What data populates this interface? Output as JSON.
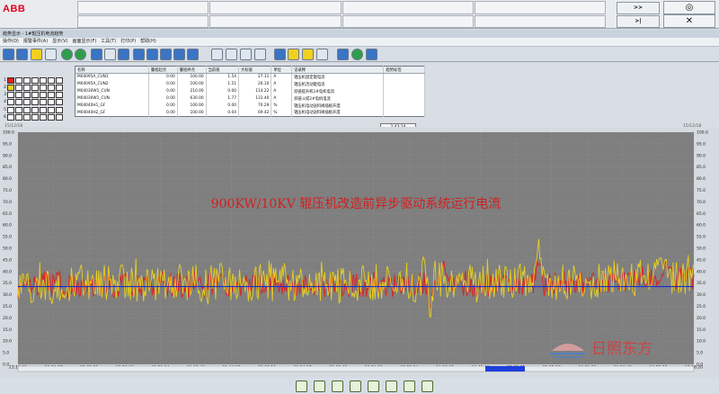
{
  "app": {
    "logo": "ABB"
  },
  "nav": {
    "forward": ">>",
    "back": ">|"
  },
  "window": {
    "title": "趋势显示 - 1#辊压机电流趋势"
  },
  "menu": [
    "操作(O)",
    "报警事件(A)",
    "显示(V)",
    "画面显示(F)",
    "工具(T)",
    "打印(P)",
    "帮助(H)"
  ],
  "legend": {
    "headers": [
      "名称",
      "量程起点",
      "量程终点",
      "当前值",
      "大标值",
      "单位",
      "记录释",
      "趋势标签"
    ],
    "rows": [
      {
        "num": "1",
        "color": "#e02020",
        "name": "M04095A_CUN1",
        "min": "0.00",
        "max": "100.00",
        "cur": "1.54",
        "big": "27.11",
        "unit": "A",
        "desc": "辊压机固定辊电流"
      },
      {
        "num": "2",
        "color": "#e8d020",
        "name": "M04095A_CUN2",
        "min": "0.00",
        "max": "100.00",
        "cur": "1.51",
        "big": "26.10",
        "unit": "A",
        "desc": "辊压机活动辊电流"
      },
      {
        "num": "3",
        "color": "#ffffff",
        "name": "M04030W1_CUN",
        "min": "0.00",
        "max": "210.00",
        "cur": "0.00",
        "big": "114.22",
        "unit": "A",
        "desc": "斜链提升机1#电机电流"
      },
      {
        "num": "4",
        "color": "#ffffff",
        "name": "M04030W1_CUN",
        "min": "0.00",
        "max": "630.00",
        "cur": "1.77",
        "big": "131.40",
        "unit": "A",
        "desc": "斜链斗提2#电机电流"
      },
      {
        "num": "5",
        "color": "#ffffff",
        "name": "M04040H1_GF",
        "min": "0.00",
        "max": "100.00",
        "cur": "0.00",
        "big": "70.29",
        "unit": "%",
        "desc": "辊压机电动送料阀插板开度"
      },
      {
        "num": "6",
        "color": "#ffffff",
        "name": "M04040H2_GF",
        "min": "0.00",
        "max": "100.00",
        "cur": "0.04",
        "big": "69.42",
        "unit": "%",
        "desc": "辊压机电动送料阀插板开度"
      }
    ]
  },
  "time_strip": {
    "left": "15/12/18",
    "center": "2:43:34",
    "right": "15/12/18"
  },
  "chart_data": {
    "type": "line",
    "title": "900KW/10KV 辊压机改造前异步驱动系统运行电流",
    "ylim": [
      0,
      100
    ],
    "y_ticks": [
      "100.0",
      "95.0",
      "90.0",
      "85.0",
      "80.0",
      "75.0",
      "70.0",
      "65.0",
      "60.0",
      "55.0",
      "50.0",
      "45.0",
      "40.0",
      "35.0",
      "30.0",
      "25.0",
      "20.0",
      "15.0",
      "10.0",
      "5.0",
      "0.0"
    ],
    "x_ticks": [
      "23:10:35",
      "23:36:37",
      "00:02:22",
      "00:28:08",
      "00:53:54",
      "01:19:40",
      "01:44:25",
      "02:10:11",
      "02:34:57",
      "03:00:43",
      "03:26:28",
      "03:52:14",
      "04:18:00",
      "04:43:46",
      "05:09:31",
      "05:35:17",
      "06:01:03",
      "06:26:49",
      "06:52:35",
      "07:18:20"
    ],
    "reference_value": 33.5,
    "grid": true,
    "series": [
      {
        "color": "#e02020",
        "base": 34,
        "noise": 5,
        "bumps": [
          [
            0.3,
            41,
            0.004
          ],
          [
            0.63,
            46,
            0.004
          ],
          [
            0.77,
            49,
            0.005
          ],
          [
            0.96,
            42,
            0.01
          ]
        ],
        "dips": [
          [
            0.61,
            24,
            0.003
          ]
        ]
      },
      {
        "color": "#e8d020",
        "base": 35,
        "noise": 8,
        "bumps": [
          [
            0.3,
            44,
            0.004
          ],
          [
            0.6,
            47,
            0.003
          ],
          [
            0.77,
            55,
            0.005
          ],
          [
            0.95,
            44,
            0.01
          ]
        ],
        "dips": [
          [
            0.61,
            20,
            0.003
          ],
          [
            0.05,
            26,
            0.004
          ]
        ]
      }
    ]
  },
  "watermark": {
    "text": "日照东方"
  }
}
